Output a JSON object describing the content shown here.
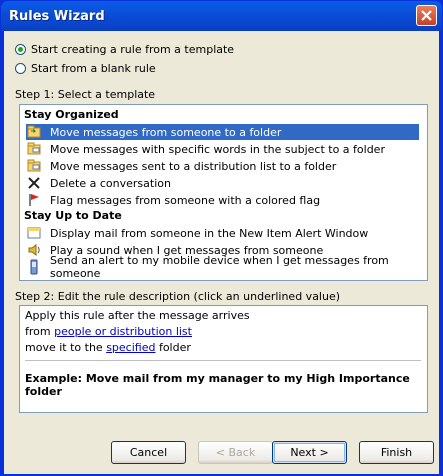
{
  "window": {
    "title": "Rules Wizard"
  },
  "options": [
    {
      "label": "Start creating a rule from a template",
      "checked": true
    },
    {
      "label": "Start from a blank rule",
      "checked": false
    }
  ],
  "step1": {
    "label": "Step 1: Select a template"
  },
  "groups": [
    {
      "name": "Stay Organized",
      "items": [
        {
          "label": "Move messages from someone to a folder",
          "icon": "folder-move-icon",
          "selected": true
        },
        {
          "label": "Move messages with specific words in the subject to a folder",
          "icon": "folder-move-icon",
          "selected": false
        },
        {
          "label": "Move messages sent to a distribution list to a folder",
          "icon": "folder-move-icon",
          "selected": false
        },
        {
          "label": "Delete a conversation",
          "icon": "delete-x-icon",
          "selected": false
        },
        {
          "label": "Flag messages from someone with a colored flag",
          "icon": "red-flag-icon",
          "selected": false
        }
      ]
    },
    {
      "name": "Stay Up to Date",
      "items": [
        {
          "label": "Display mail from someone in the New Item Alert Window",
          "icon": "alert-window-icon",
          "selected": false
        },
        {
          "label": "Play a sound when I get messages from someone",
          "icon": "sound-icon",
          "selected": false
        },
        {
          "label": "Send an alert to my mobile device when I get messages from someone",
          "icon": "mobile-device-icon",
          "selected": false
        }
      ]
    }
  ],
  "step2": {
    "label": "Step 2: Edit the rule description (click an underlined value)"
  },
  "description": {
    "line1": "Apply this rule after the message arrives",
    "line2_prefix": "from ",
    "line2_link": "people or distribution list",
    "line3_prefix": "move it to the ",
    "line3_link": "specified",
    "line3_suffix": " folder",
    "example": "Example: Move mail from my manager to my High Importance folder"
  },
  "buttons": {
    "cancel": "Cancel",
    "back": "< Back",
    "next": "Next >",
    "finish": "Finish"
  },
  "colors": {
    "selection": "#316ac5",
    "link": "#0000cc",
    "titlebar": "#0a4fd8"
  }
}
